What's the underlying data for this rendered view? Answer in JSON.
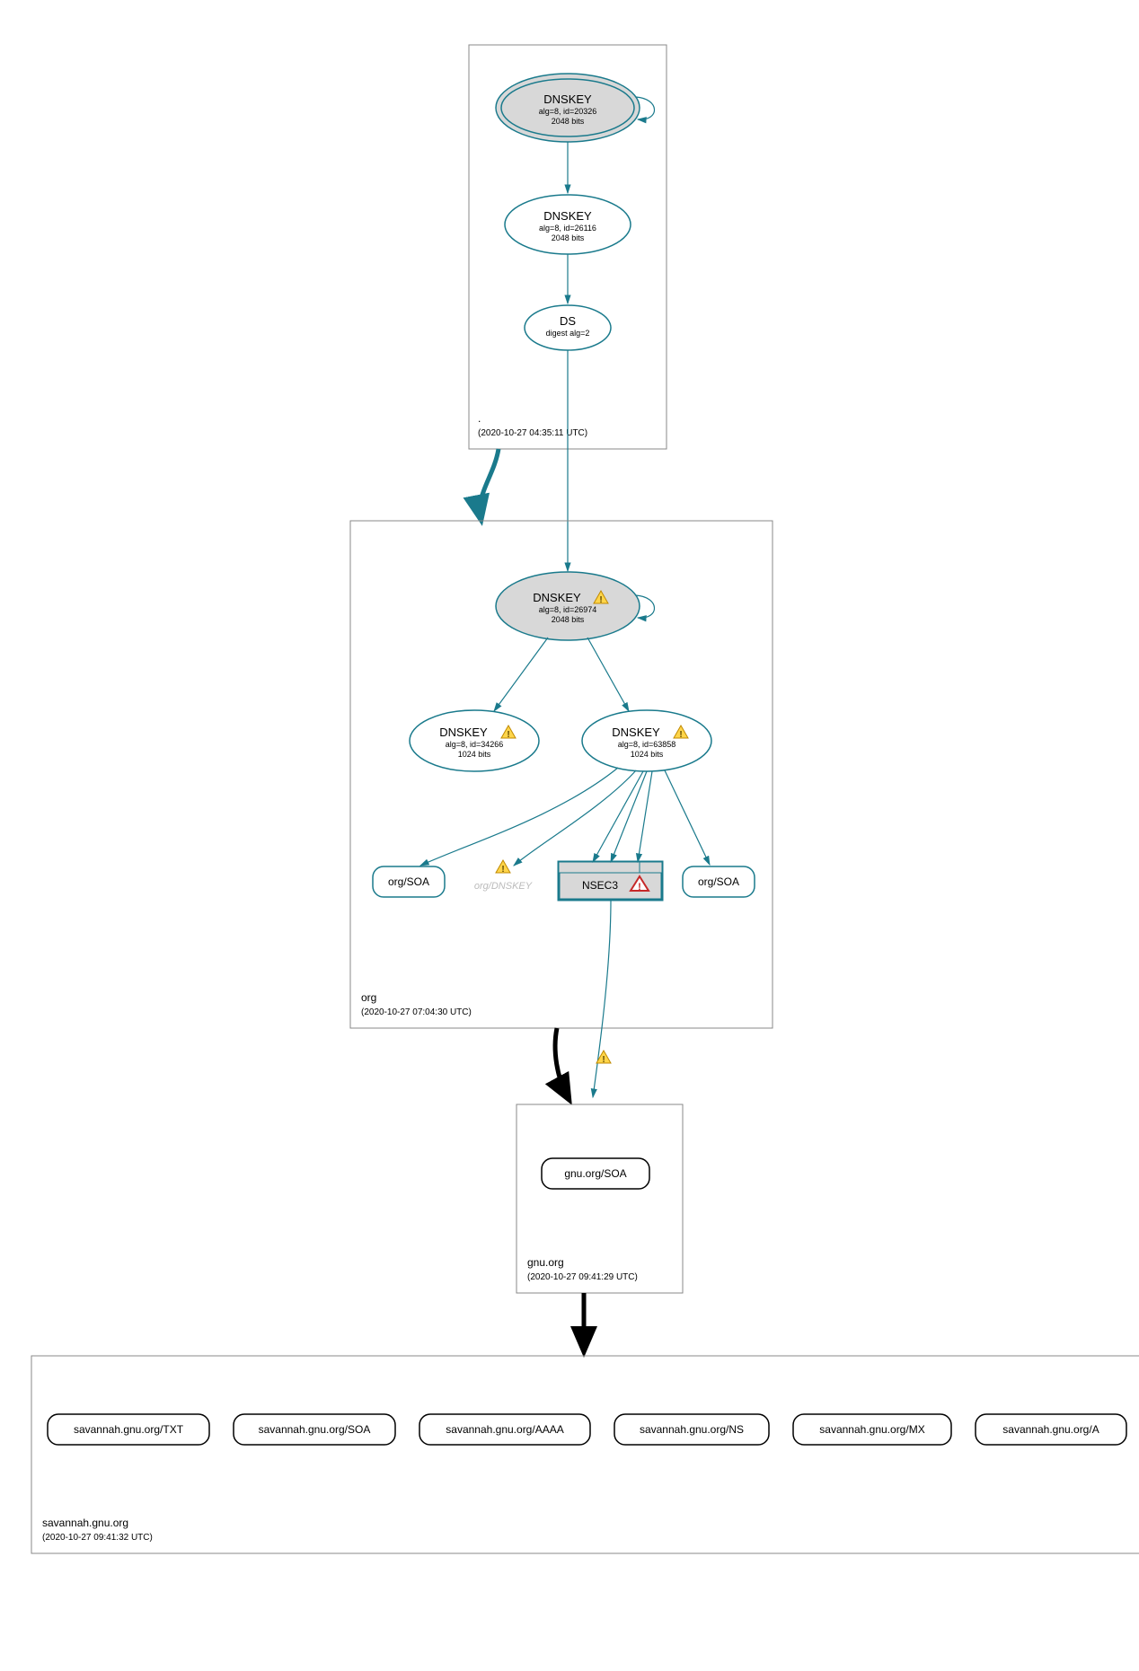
{
  "zones": {
    "root": {
      "name": ".",
      "timestamp": "(2020-10-27 04:35:11 UTC)",
      "nodes": {
        "ksk": {
          "title": "DNSKEY",
          "sub1": "alg=8, id=20326",
          "sub2": "2048 bits"
        },
        "zsk": {
          "title": "DNSKEY",
          "sub1": "alg=8, id=26116",
          "sub2": "2048 bits"
        },
        "ds": {
          "title": "DS",
          "sub1": "digest alg=2"
        }
      }
    },
    "org": {
      "name": "org",
      "timestamp": "(2020-10-27 07:04:30 UTC)",
      "nodes": {
        "ksk": {
          "title": "DNSKEY",
          "sub1": "alg=8, id=26974",
          "sub2": "2048 bits"
        },
        "zsk1": {
          "title": "DNSKEY",
          "sub1": "alg=8, id=34266",
          "sub2": "1024 bits"
        },
        "zsk2": {
          "title": "DNSKEY",
          "sub1": "alg=8, id=63858",
          "sub2": "1024 bits"
        },
        "soa1": {
          "title": "org/SOA"
        },
        "ghost": {
          "title": "org/DNSKEY"
        },
        "nsec3": {
          "title": "NSEC3"
        },
        "soa2": {
          "title": "org/SOA"
        }
      }
    },
    "gnu": {
      "name": "gnu.org",
      "timestamp": "(2020-10-27 09:41:29 UTC)",
      "nodes": {
        "soa": {
          "title": "gnu.org/SOA"
        }
      }
    },
    "savannah": {
      "name": "savannah.gnu.org",
      "timestamp": "(2020-10-27 09:41:32 UTC)",
      "nodes": {
        "txt": {
          "title": "savannah.gnu.org/TXT"
        },
        "soa": {
          "title": "savannah.gnu.org/SOA"
        },
        "aaaa": {
          "title": "savannah.gnu.org/AAAA"
        },
        "ns": {
          "title": "savannah.gnu.org/NS"
        },
        "mx": {
          "title": "savannah.gnu.org/MX"
        },
        "a": {
          "title": "savannah.gnu.org/A"
        }
      }
    }
  }
}
